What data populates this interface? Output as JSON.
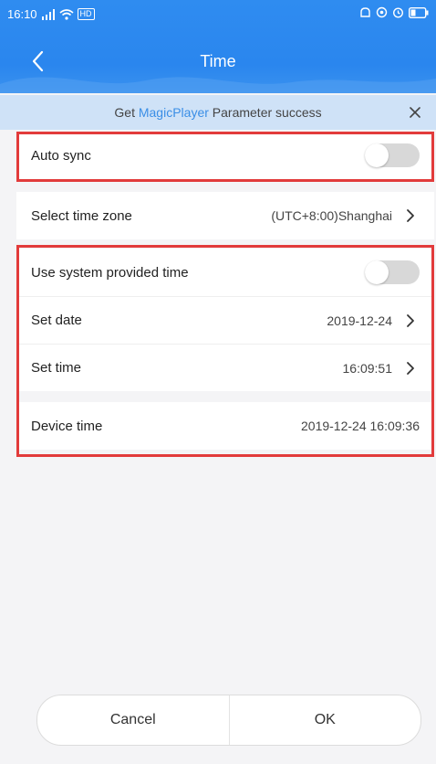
{
  "status_bar": {
    "time": "16:10",
    "signal_text": "4G",
    "network_badge": "HD"
  },
  "header": {
    "title": "Time",
    "back_icon": "chevron-left-icon"
  },
  "notice": {
    "prefix": "Get ",
    "brand": "MagicPlayer",
    "suffix": " Parameter success",
    "close_icon": "close-icon"
  },
  "sections": {
    "auto_sync": {
      "label": "Auto sync",
      "enabled": false
    },
    "time_zone": {
      "label": "Select time zone",
      "value": "(UTC+8:00)Shanghai"
    },
    "system_time": {
      "label": "Use system provided time",
      "enabled": false
    },
    "set_date": {
      "label": "Set date",
      "value": "2019-12-24"
    },
    "set_time": {
      "label": "Set time",
      "value": "16:09:51"
    },
    "device_time": {
      "label": "Device time",
      "value": "2019-12-24 16:09:36"
    }
  },
  "buttons": {
    "cancel": "Cancel",
    "ok": "OK"
  },
  "colors": {
    "header": "#2f8cf0",
    "notice_bg": "#cfe2f7",
    "brand_text": "#3a8ee6",
    "highlight": "#e23b3b",
    "toggle_off": "#d8d8d8"
  }
}
